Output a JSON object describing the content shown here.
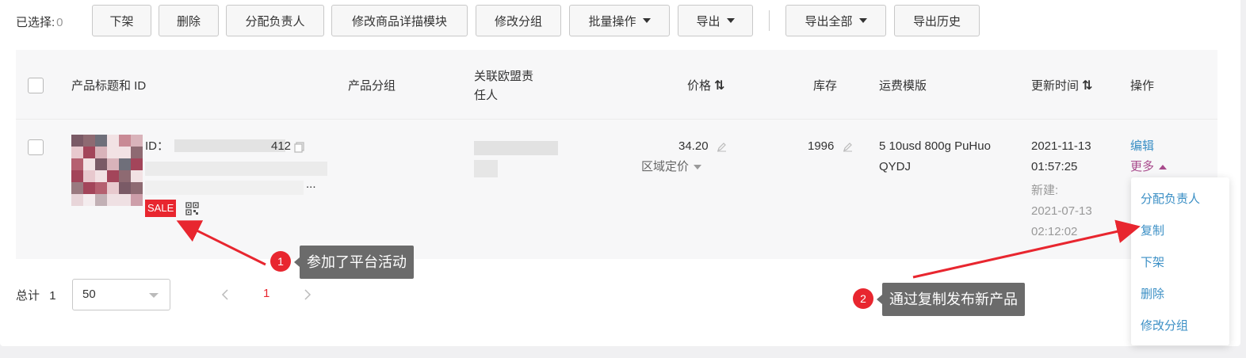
{
  "toolbar": {
    "selected_label": "已选择:",
    "selected_count": "0",
    "buttons": {
      "delist": "下架",
      "delete": "删除",
      "assign_owner": "分配负责人",
      "edit_detail_module": "修改商品详描模块",
      "edit_group": "修改分组",
      "batch_ops": "批量操作",
      "export": "导出",
      "export_all": "导出全部",
      "export_history": "导出历史"
    }
  },
  "table": {
    "headers": {
      "title_id": "产品标题和 ID",
      "group": "产品分组",
      "affiliate_line1": "关联欧盟责",
      "affiliate_line2": "任人",
      "price": "价格",
      "stock": "库存",
      "shipping_template": "运费模版",
      "updated_time": "更新时间",
      "actions": "操作"
    },
    "row": {
      "id_prefix": "ID：",
      "id_visible_suffix": "412",
      "title_ellipsis": "...",
      "sale_badge": "SALE",
      "price": "34.20",
      "regional_pricing": "区域定价",
      "stock": "1996",
      "shipping_line1": "5 10usd 800g PuHuo",
      "shipping_line2": "QYDJ",
      "updated_date": "2021-11-13",
      "updated_time": "01:57:25",
      "created_label": "新建:",
      "created_date": "2021-07-13",
      "created_time": "02:12:02",
      "action_edit": "编辑",
      "action_more": "更多"
    }
  },
  "dropdown": {
    "items": [
      "分配负责人",
      "复制",
      "下架",
      "删除",
      "修改分组"
    ]
  },
  "footer": {
    "total_label": "总计",
    "total_count": "1",
    "page_size": "50",
    "current_page": "1",
    "prev_icon": "chevron-left-icon",
    "next_icon": "chevron-right-icon"
  },
  "annotations": {
    "one_num": "1",
    "one_text": "参加了平台活动",
    "two_num": "2",
    "two_text": "通过复制发布新产品"
  },
  "colors": {
    "accent_red": "#e8262f",
    "link_blue": "#3b8fc5",
    "more_purple": "#a84a8c",
    "callout_grey": "#6b6b6b"
  }
}
